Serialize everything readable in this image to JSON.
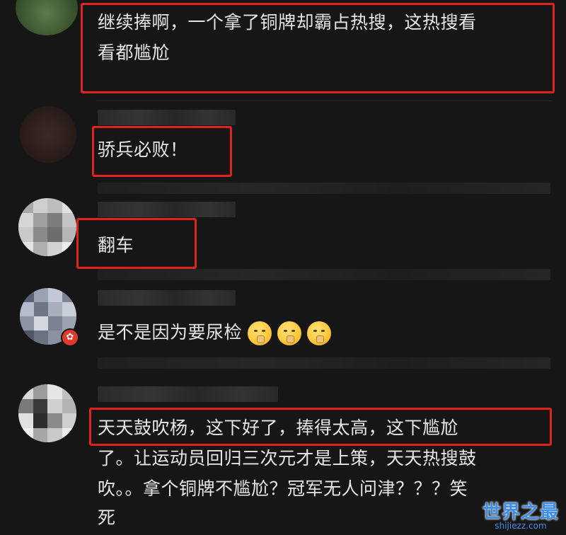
{
  "comments": [
    {
      "text_line1": "继续捧啊，一个拿了铜牌却霸占热搜，这热搜看",
      "text_line2": "看都尴尬"
    },
    {
      "text": "骄兵必败！"
    },
    {
      "text": "翻车"
    },
    {
      "text": "是不是因为要尿检",
      "emojis": [
        "shushing-face-icon",
        "shushing-face-icon",
        "shushing-face-icon"
      ],
      "badge": "✿"
    },
    {
      "text_line1": "天天鼓吹杨，这下好了，捧得太高，这下尴尬",
      "text_line2": "了。让运动员回归三次元才是上策，天天热搜鼓",
      "text_line3": "吹。。拿个铜牌不尴尬？冠军无人问津？？？笑",
      "text_line4": "死"
    }
  ],
  "watermark": {
    "main": "世界之最",
    "sub": "shijiezz.com"
  },
  "colors": {
    "background": "#161616",
    "highlight": "#e0241d",
    "text": "#e6e6e6",
    "watermark": "#3e8ee8"
  }
}
